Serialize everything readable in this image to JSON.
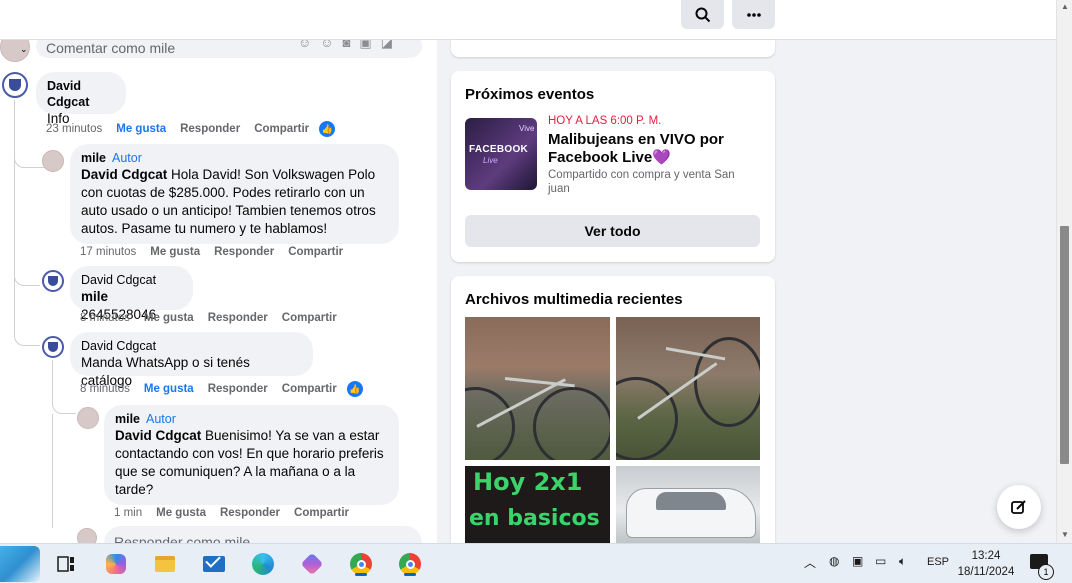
{
  "comments_panel": {
    "comment_placeholder": "Comentar como mile",
    "reply_placeholder": "Responder como mile",
    "comments": [
      {
        "author": "David Cdgcat",
        "text": "Info",
        "time": "23 minutos",
        "like": "Me gusta",
        "reply": "Responder",
        "share": "Compartir",
        "liked": true
      },
      {
        "author": "mile",
        "author_badge": "Autor",
        "mention": "David Cdgcat",
        "text": "Hola David! Son Volkswagen Polo con cuotas de $285.000. Podes retirarlo con un auto usado o un anticipo! Tambien tenemos otros autos. Pasame tu numero y te hablamos!",
        "time": "17 minutos",
        "like": "Me gusta",
        "reply": "Responder",
        "share": "Compartir"
      },
      {
        "author": "David Cdgcat",
        "mention": "mile",
        "text": "2645528046",
        "time": "8 minutos",
        "like": "Me gusta",
        "reply": "Responder",
        "share": "Compartir"
      },
      {
        "author": "David Cdgcat",
        "text": "Manda WhatsApp o si tenés catálogo",
        "time": "8 minutos",
        "like": "Me gusta",
        "reply": "Responder",
        "share": "Compartir",
        "liked": true
      },
      {
        "author": "mile",
        "author_badge": "Autor",
        "mention": "David Cdgcat",
        "text": "Buenisimo! Ya se van a estar contactando con vos! En que horario preferis que se comuniquen? A la mañana o a la tarde?",
        "time": "1 min",
        "like": "Me gusta",
        "reply": "Responder",
        "share": "Compartir"
      }
    ]
  },
  "events_card": {
    "title": "Próximos eventos",
    "event": {
      "time": "HOY A LAS 6:00 P. M.",
      "name": "Malibujeans en VIVO por Facebook Live💜",
      "organizer": "Compartido con compra y venta San juan",
      "thumb_text_top": "Vive",
      "thumb_text_main": "FACEBOOK",
      "thumb_text_sub": "Live"
    },
    "see_all": "Ver todo"
  },
  "media_card": {
    "title": "Archivos multimedia recientes",
    "promo_line1": "Hoy 2x1",
    "promo_line2": "en basicos"
  },
  "taskbar": {
    "language": "ESP",
    "time": "13:24",
    "date": "18/11/2024",
    "notification_count": "1"
  },
  "colors": {
    "accent": "#1877f2",
    "event_time": "#e41e3f",
    "bubble": "#f0f2f5"
  }
}
